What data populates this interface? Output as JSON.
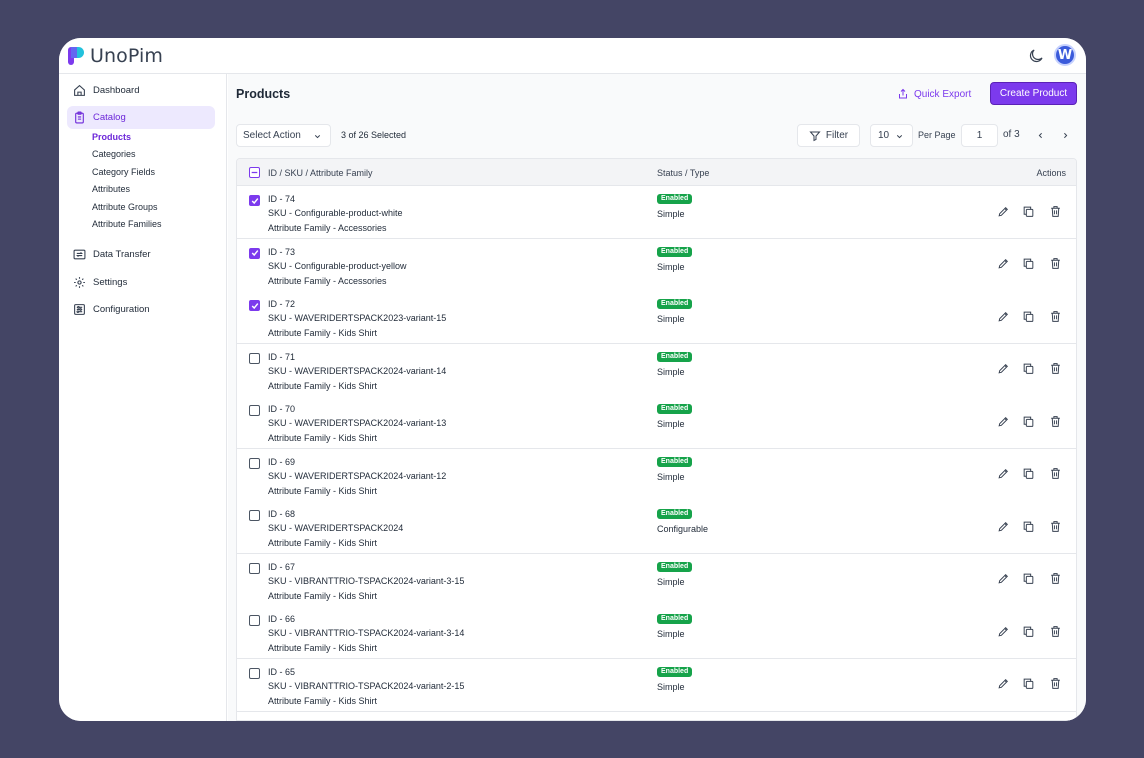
{
  "header": {
    "logo_text": "UnoPim",
    "avatar_letter": "W"
  },
  "sidebar": {
    "items": [
      {
        "label": "Dashboard",
        "icon": "home-icon",
        "active": false
      },
      {
        "label": "Catalog",
        "icon": "clipboard-icon",
        "active": true
      },
      {
        "label": "Data Transfer",
        "icon": "transfer-icon",
        "active": false
      },
      {
        "label": "Settings",
        "icon": "gear-icon",
        "active": false
      },
      {
        "label": "Configuration",
        "icon": "sliders-icon",
        "active": false
      }
    ],
    "catalog_sub": [
      {
        "label": "Products",
        "active": true
      },
      {
        "label": "Categories",
        "active": false
      },
      {
        "label": "Category Fields",
        "active": false
      },
      {
        "label": "Attributes",
        "active": false
      },
      {
        "label": "Attribute Groups",
        "active": false
      },
      {
        "label": "Attribute Families",
        "active": false
      }
    ]
  },
  "main": {
    "title": "Products",
    "quick_export_label": "Quick Export",
    "create_label": "Create Product",
    "toolbar": {
      "select_action_label": "Select Action",
      "selected_text": "3 of 26 Selected",
      "filter_label": "Filter",
      "per_page_value": "10",
      "per_page_label": "Per Page",
      "page_value": "1",
      "page_of": "of 3"
    },
    "table": {
      "headers": {
        "id": "ID / SKU / Attribute Family",
        "status": "Status / Type",
        "actions": "Actions"
      },
      "rows": [
        {
          "id": "ID - 74",
          "sku": "SKU - Configurable-product-white",
          "family": "Attribute Family - Accessories",
          "status": "Enabled",
          "type": "Simple",
          "checked": true
        },
        {
          "id": "ID - 73",
          "sku": "SKU - Configurable-product-yellow",
          "family": "Attribute Family - Accessories",
          "status": "Enabled",
          "type": "Simple",
          "checked": true
        },
        {
          "id": "ID - 72",
          "sku": "SKU - WAVERIDERTSPACK2023-variant-15",
          "family": "Attribute Family - Kids Shirt",
          "status": "Enabled",
          "type": "Simple",
          "checked": true
        },
        {
          "id": "ID - 71",
          "sku": "SKU - WAVERIDERTSPACK2024-variant-14",
          "family": "Attribute Family - Kids Shirt",
          "status": "Enabled",
          "type": "Simple",
          "checked": false
        },
        {
          "id": "ID - 70",
          "sku": "SKU - WAVERIDERTSPACK2024-variant-13",
          "family": "Attribute Family - Kids Shirt",
          "status": "Enabled",
          "type": "Simple",
          "checked": false
        },
        {
          "id": "ID - 69",
          "sku": "SKU - WAVERIDERTSPACK2024-variant-12",
          "family": "Attribute Family - Kids Shirt",
          "status": "Enabled",
          "type": "Simple",
          "checked": false
        },
        {
          "id": "ID - 68",
          "sku": "SKU - WAVERIDERTSPACK2024",
          "family": "Attribute Family - Kids Shirt",
          "status": "Enabled",
          "type": "Configurable",
          "checked": false
        },
        {
          "id": "ID - 67",
          "sku": "SKU - VIBRANTTRIO-TSPACK2024-variant-3-15",
          "family": "Attribute Family - Kids Shirt",
          "status": "Enabled",
          "type": "Simple",
          "checked": false
        },
        {
          "id": "ID - 66",
          "sku": "SKU - VIBRANTTRIO-TSPACK2024-variant-3-14",
          "family": "Attribute Family - Kids Shirt",
          "status": "Enabled",
          "type": "Simple",
          "checked": false
        },
        {
          "id": "ID - 65",
          "sku": "SKU - VIBRANTTRIO-TSPACK2024-variant-2-15",
          "family": "Attribute Family - Kids Shirt",
          "status": "Enabled",
          "type": "Simple",
          "checked": false
        }
      ]
    }
  },
  "colors": {
    "accent": "#7c3aed",
    "status_enabled": "#16a34a",
    "backdrop": "#444565"
  }
}
